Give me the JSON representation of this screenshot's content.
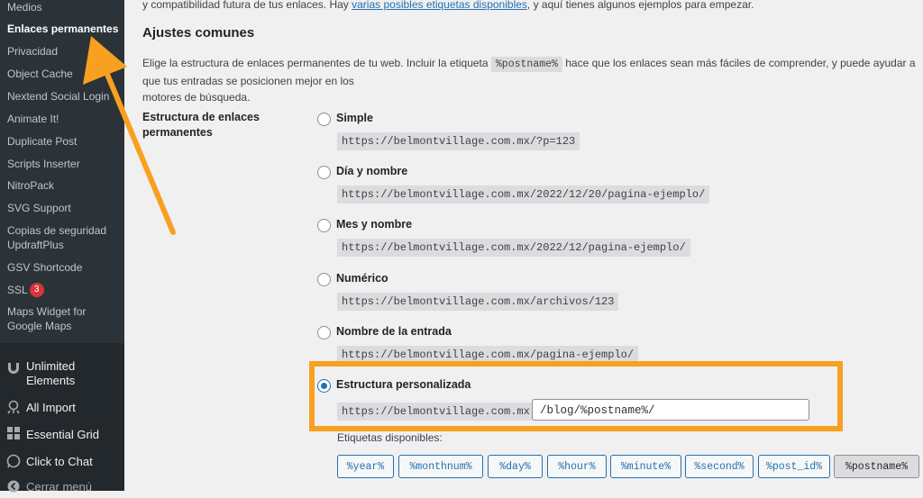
{
  "sidebar": {
    "submenu": [
      {
        "label": "Medios"
      },
      {
        "label": "Enlaces permanentes",
        "current": true
      },
      {
        "label": "Privacidad"
      },
      {
        "label": "Object Cache"
      },
      {
        "label": "Nextend Social Login"
      },
      {
        "label": "Animate It!"
      },
      {
        "label": "Duplicate Post"
      },
      {
        "label": "Scripts Inserter"
      },
      {
        "label": "NitroPack"
      },
      {
        "label": "SVG Support"
      },
      {
        "label": "Copias de seguridad",
        "label2": "UpdraftPlus"
      },
      {
        "label": "GSV Shortcode"
      },
      {
        "label": "SSL",
        "badge": "3"
      },
      {
        "label": "Maps Widget for",
        "label2": "Google Maps"
      }
    ],
    "plugins": [
      {
        "label": "Unlimited",
        "label2": "Elements",
        "icon": "unlimited-elements-icon"
      },
      {
        "label": "All Import",
        "icon": "all-import-icon"
      },
      {
        "label": "Essential Grid",
        "icon": "grid-icon"
      },
      {
        "label": "Click to Chat",
        "icon": "whatsapp-icon"
      },
      {
        "label": "Cerrar menú",
        "icon": "collapse-icon"
      }
    ]
  },
  "main": {
    "intro_text": "y compatibilidad futura de tus enlaces. Hay ",
    "intro_link": "varias posibles etiquetas disponibles",
    "intro_text_end": ", y aquí tienes algunos ejemplos para empezar.",
    "section_title": "Ajustes comunes",
    "desc_start": "Elige la estructura de enlaces permanentes de tu web. Incluir la etiqueta ",
    "desc_tag": "%postname%",
    "desc_end": " hace que los enlaces sean más fáciles de comprender, y puede ayudar a que tus entradas se posicionen mejor en los",
    "desc_line2": "motores de búsqueda.",
    "row_label_1": "Estructura de enlaces",
    "row_label_2": "permanentes",
    "options": [
      {
        "label": "Simple",
        "example": "https://belmontvillage.com.mx/?p=123",
        "checked": false
      },
      {
        "label": "Día y nombre",
        "example": "https://belmontvillage.com.mx/2022/12/20/pagina-ejemplo/",
        "checked": false
      },
      {
        "label": "Mes y nombre",
        "example": "https://belmontvillage.com.mx/2022/12/pagina-ejemplo/",
        "checked": false
      },
      {
        "label": "Numérico",
        "example": "https://belmontvillage.com.mx/archivos/123",
        "checked": false
      },
      {
        "label": "Nombre de la entrada",
        "example": "https://belmontvillage.com.mx/pagina-ejemplo/",
        "checked": false
      },
      {
        "label": "Estructura personalizada",
        "example": "https://belmontvillage.com.mx",
        "checked": true
      }
    ],
    "custom_value": "/blog/%postname%/",
    "available_tags_label": "Etiquetas disponibles:",
    "tags": [
      "%year%",
      "%monthnum%",
      "%day%",
      "%hour%",
      "%minute%",
      "%second%",
      "%post_id%",
      "%postname%"
    ],
    "active_tag": "%postname%"
  },
  "annotation": {
    "color": "#f8a020"
  }
}
